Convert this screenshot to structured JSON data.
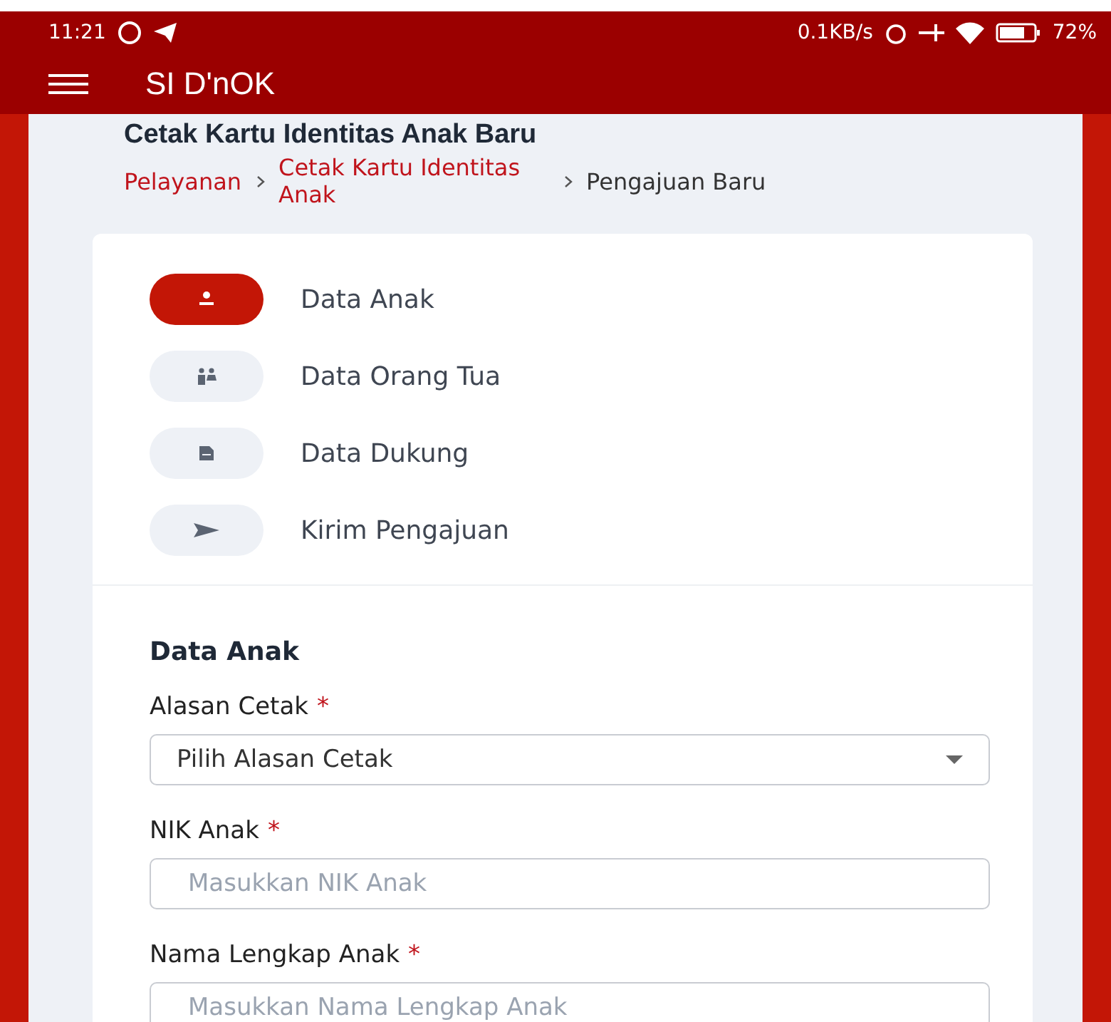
{
  "status_bar": {
    "time": "11:21",
    "speed": "0.1KB/s",
    "battery": "72%"
  },
  "app_bar": {
    "title": "SI D'nOK"
  },
  "page": {
    "title": "Cetak Kartu Identitas Anak Baru",
    "breadcrumb": [
      {
        "label": "Pelayanan",
        "link": true
      },
      {
        "label": "Cetak Kartu Identitas Anak",
        "link": true
      },
      {
        "label": "Pengajuan Baru",
        "link": false
      }
    ]
  },
  "steps": [
    {
      "label": "Data Anak",
      "kind": "person",
      "selected": true
    },
    {
      "label": "Data Orang Tua",
      "kind": "parents",
      "selected": false
    },
    {
      "label": "Data Dukung",
      "kind": "document",
      "selected": false
    },
    {
      "label": "Kirim Pengajuan",
      "kind": "send",
      "selected": false
    }
  ],
  "form": {
    "title": "Data Anak",
    "fields": [
      {
        "label": "Alasan Cetak",
        "required_mark": "*",
        "kind": "select",
        "value": "Pilih Alasan Cetak"
      },
      {
        "label": "NIK Anak",
        "required_mark": "*",
        "kind": "text",
        "placeholder": "Masukkan NIK Anak"
      },
      {
        "label": "Nama Lengkap Anak",
        "required_mark": "*",
        "kind": "text",
        "placeholder": "Masukkan Nama Lengkap Anak"
      }
    ]
  }
}
